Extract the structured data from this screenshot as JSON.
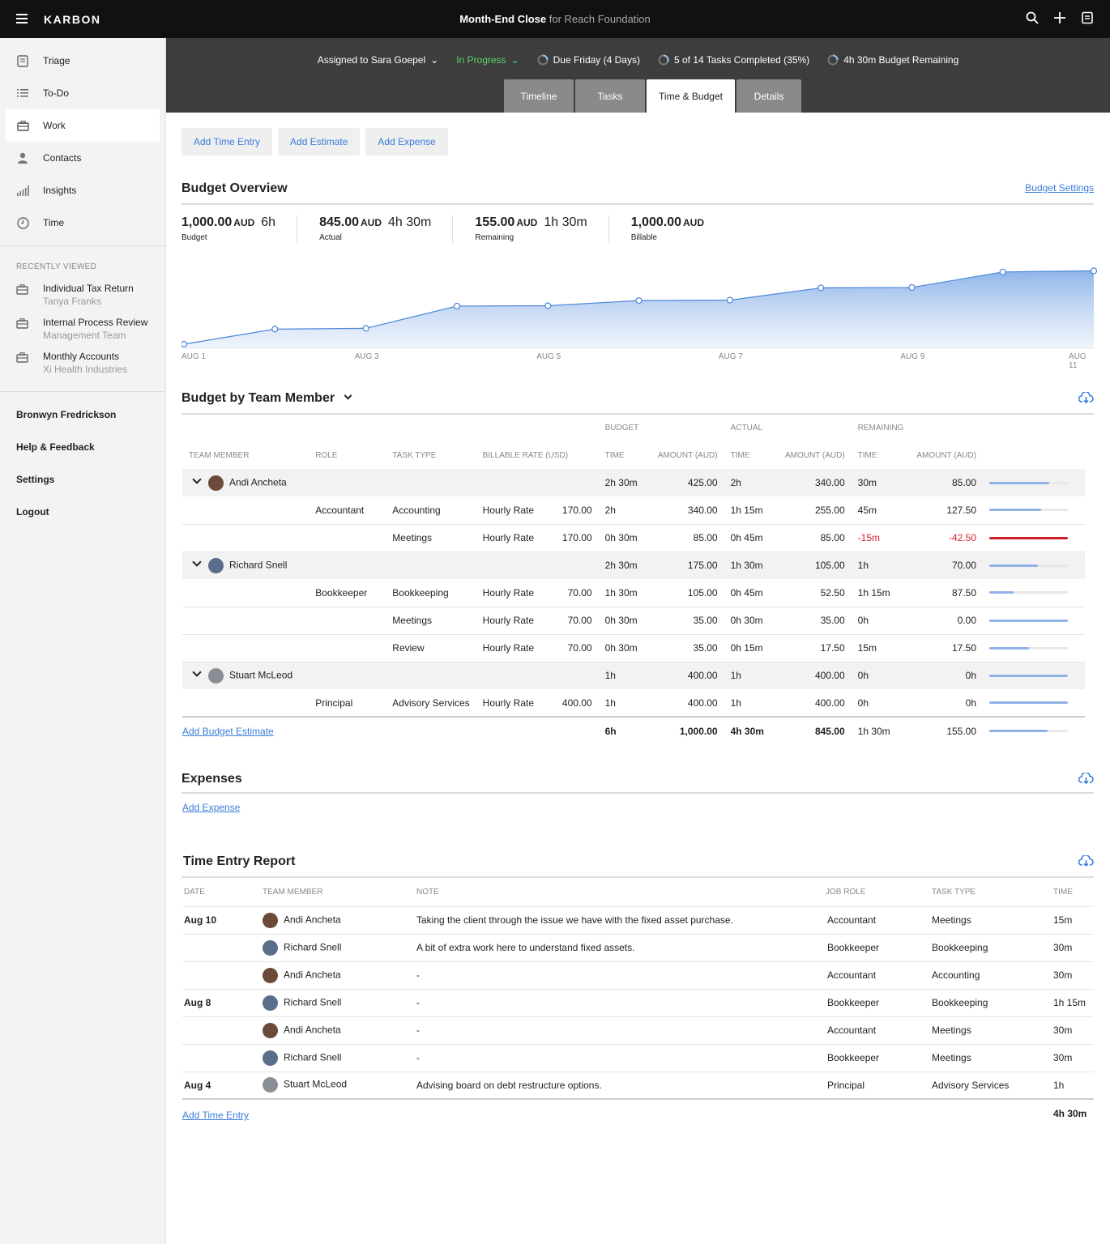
{
  "app": {
    "brand": "KARBON",
    "job_title": "Month-End Close",
    "job_for": "for Reach Foundation"
  },
  "sidebar": {
    "nav": [
      {
        "label": "Triage",
        "icon": "triage-icon"
      },
      {
        "label": "To-Do",
        "icon": "todo-list-icon"
      },
      {
        "label": "Work",
        "icon": "briefcase-icon"
      },
      {
        "label": "Contacts",
        "icon": "person-icon"
      },
      {
        "label": "Insights",
        "icon": "bar-chart-icon"
      },
      {
        "label": "Time",
        "icon": "clock-icon"
      }
    ],
    "recent_title": "RECENTLY VIEWED",
    "recent": [
      {
        "name": "Individual Tax Return",
        "sub": "Tanya Franks"
      },
      {
        "name": "Internal Process Review",
        "sub": "Management Team"
      },
      {
        "name": "Monthly Accounts",
        "sub": "Xi Health Industries"
      }
    ],
    "user": "Bronwyn Fredrickson",
    "help": "Help & Feedback",
    "settings": "Settings",
    "logout": "Logout"
  },
  "job": {
    "assigned": "Assigned to Sara Goepel",
    "status": "In Progress",
    "due": "Due Friday (4 Days)",
    "tasks": "5 of 14 Tasks Completed (35%)",
    "budget_remaining": "4h 30m Budget Remaining",
    "tabs": [
      "Timeline",
      "Tasks",
      "Time & Budget",
      "Details"
    ]
  },
  "actions": {
    "add_time": "Add Time Entry",
    "add_estimate": "Add Estimate",
    "add_expense": "Add Expense"
  },
  "overview": {
    "title": "Budget Overview",
    "settings_link": "Budget Settings",
    "stats": [
      {
        "amount": "1,000.00",
        "unit": "AUD",
        "time": "6h",
        "label": "Budget"
      },
      {
        "amount": "845.00",
        "unit": "AUD",
        "time": "4h 30m",
        "label": "Actual"
      },
      {
        "amount": "155.00",
        "unit": "AUD",
        "time": "1h 30m",
        "label": "Remaining"
      },
      {
        "amount": "1,000.00",
        "unit": "AUD",
        "time": "",
        "label": "Billable"
      }
    ]
  },
  "chart_data": {
    "type": "area",
    "x": [
      "AUG 1",
      "AUG 2",
      "AUG 3",
      "AUG 4",
      "AUG 5",
      "AUG 6",
      "AUG 7",
      "AUG 8",
      "AUG 9",
      "AUG 10",
      "AUG 11"
    ],
    "tick_labels": [
      "AUG 1",
      "AUG 3",
      "AUG 5",
      "AUG 7",
      "AUG 9",
      "AUG 11"
    ],
    "values": [
      0,
      19,
      20,
      48,
      48.5,
      55,
      55.5,
      71,
      71.5,
      91,
      92.5
    ],
    "ylim": [
      0,
      100
    ],
    "color": "#4a86d9",
    "grid": false
  },
  "team": {
    "title": "Budget by Team Member",
    "group_headers": {
      "budget": "BUDGET",
      "actual": "ACTUAL",
      "remaining": "REMAINING"
    },
    "columns": [
      "TEAM MEMBER",
      "ROLE",
      "TASK TYPE",
      "BILLABLE RATE (USD)",
      "TIME",
      "AMOUNT (AUD)",
      "TIME",
      "AMOUNT (AUD)",
      "TIME",
      "AMOUNT (AUD)"
    ],
    "members": [
      {
        "name": "Andi Ancheta",
        "avatar_color": "#6b4a3a",
        "b_time": "2h 30m",
        "b_amt": "425.00",
        "a_time": "2h",
        "a_amt": "340.00",
        "r_time": "30m",
        "r_amt": "85.00",
        "progress": 0.76,
        "over": false,
        "rows": [
          {
            "role": "Accountant",
            "task": "Accounting",
            "rate_type": "Hourly Rate",
            "rate": "170.00",
            "b_time": "2h",
            "b_amt": "340.00",
            "a_time": "1h 15m",
            "a_amt": "255.00",
            "r_time": "45m",
            "r_amt": "127.50",
            "progress": 0.66,
            "over": false
          },
          {
            "role": "",
            "task": "Meetings",
            "rate_type": "Hourly Rate",
            "rate": "170.00",
            "b_time": "0h 30m",
            "b_amt": "85.00",
            "a_time": "0h 45m",
            "a_amt": "85.00",
            "r_time": "-15m",
            "r_amt": "-42.50",
            "progress": 1.0,
            "over": true
          }
        ]
      },
      {
        "name": "Richard Snell",
        "avatar_color": "#5a6d8a",
        "b_time": "2h 30m",
        "b_amt": "175.00",
        "a_time": "1h 30m",
        "a_amt": "105.00",
        "r_time": "1h",
        "r_amt": "70.00",
        "progress": 0.62,
        "over": false,
        "rows": [
          {
            "role": "Bookkeeper",
            "task": "Bookkeeping",
            "rate_type": "Hourly Rate",
            "rate": "70.00",
            "b_time": "1h 30m",
            "b_amt": "105.00",
            "a_time": "0h 45m",
            "a_amt": "52.50",
            "r_time": "1h 15m",
            "r_amt": "87.50",
            "progress": 0.31,
            "over": false
          },
          {
            "role": "",
            "task": "Meetings",
            "rate_type": "Hourly Rate",
            "rate": "70.00",
            "b_time": "0h 30m",
            "b_amt": "35.00",
            "a_time": "0h 30m",
            "a_amt": "35.00",
            "r_time": "0h",
            "r_amt": "0.00",
            "progress": 1.0,
            "over": false
          },
          {
            "role": "",
            "task": "Review",
            "rate_type": "Hourly Rate",
            "rate": "70.00",
            "b_time": "0h 30m",
            "b_amt": "35.00",
            "a_time": "0h 15m",
            "a_amt": "17.50",
            "r_time": "15m",
            "r_amt": "17.50",
            "progress": 0.5,
            "over": false
          }
        ]
      },
      {
        "name": "Stuart McLeod",
        "avatar_color": "#8a8f96",
        "b_time": "1h",
        "b_amt": "400.00",
        "a_time": "1h",
        "a_amt": "400.00",
        "r_time": "0h",
        "r_amt": "0h",
        "progress": 1.0,
        "over": false,
        "rows": [
          {
            "role": "Principal",
            "task": "Advisory Services",
            "rate_type": "Hourly Rate",
            "rate": "400.00",
            "b_time": "1h",
            "b_amt": "400.00",
            "a_time": "1h",
            "a_amt": "400.00",
            "r_time": "0h",
            "r_amt": "0h",
            "progress": 1.0,
            "over": false
          }
        ]
      }
    ],
    "add_link": "Add Budget Estimate",
    "total": {
      "b_time": "6h",
      "b_amt": "1,000.00",
      "a_time": "4h 30m",
      "a_amt": "845.00",
      "r_time": "1h 30m",
      "r_amt": "155.00",
      "progress": 0.74
    }
  },
  "expenses": {
    "title": "Expenses",
    "add_link": "Add Expense"
  },
  "time_report": {
    "title": "Time Entry Report",
    "columns": [
      "DATE",
      "TEAM MEMBER",
      "NOTE",
      "JOB ROLE",
      "TASK TYPE",
      "TIME"
    ],
    "rows": [
      {
        "date": "Aug 10",
        "member": "Andi Ancheta",
        "avatar_color": "#6b4a3a",
        "note": "Taking the client through the issue we have with the fixed asset purchase.",
        "role": "Accountant",
        "task": "Meetings",
        "time": "15m"
      },
      {
        "date": "",
        "member": "Richard Snell",
        "avatar_color": "#5a6d8a",
        "note": "A bit of extra work here to understand fixed assets.",
        "role": "Bookkeeper",
        "task": "Bookkeeping",
        "time": "30m"
      },
      {
        "date": "",
        "member": "Andi Ancheta",
        "avatar_color": "#6b4a3a",
        "note": "-",
        "role": "Accountant",
        "task": "Accounting",
        "time": "30m"
      },
      {
        "date": "Aug 8",
        "member": "Richard Snell",
        "avatar_color": "#5a6d8a",
        "note": "-",
        "role": "Bookkeeper",
        "task": "Bookkeeping",
        "time": "1h 15m"
      },
      {
        "date": "",
        "member": "Andi Ancheta",
        "avatar_color": "#6b4a3a",
        "note": "-",
        "role": "Accountant",
        "task": "Meetings",
        "time": "30m"
      },
      {
        "date": "",
        "member": "Richard Snell",
        "avatar_color": "#5a6d8a",
        "note": "-",
        "role": "Bookkeeper",
        "task": "Meetings",
        "time": "30m"
      },
      {
        "date": "Aug 4",
        "member": "Stuart McLeod",
        "avatar_color": "#8a8f96",
        "note": "Advising board on debt restructure options.",
        "role": "Principal",
        "task": "Advisory Services",
        "time": "1h"
      }
    ],
    "add_link": "Add Time Entry",
    "total": "4h 30m"
  }
}
